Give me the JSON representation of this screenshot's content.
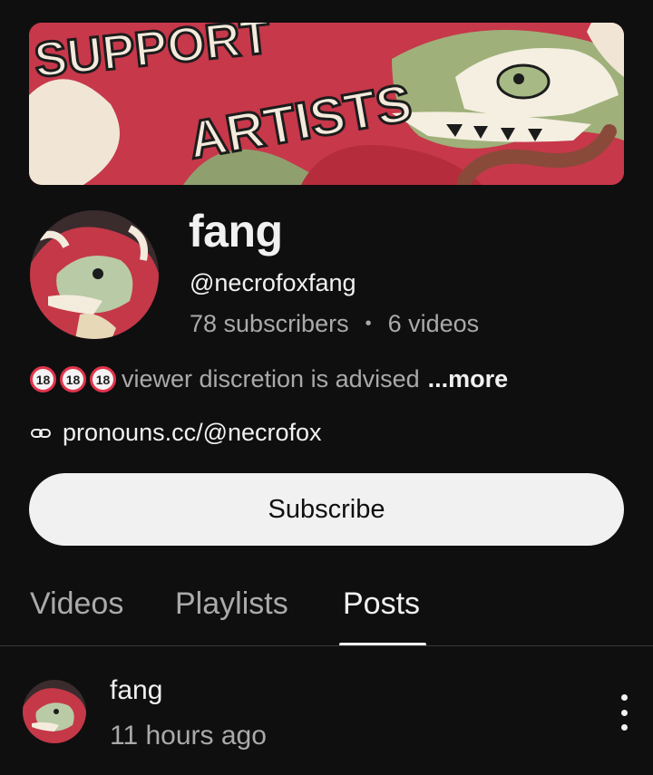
{
  "banner": {
    "text_top": "SUPPORT",
    "text_bottom": "ARTISTS"
  },
  "channel": {
    "name": "fang",
    "handle": "@necrofoxfang",
    "subscribers": "78 subscribers",
    "separator": "•",
    "videos": "6 videos",
    "badge_label": "18",
    "description": "viewer discretion is advised",
    "more_label": "...more",
    "link": "pronouns.cc/@necrofox"
  },
  "subscribe_label": "Subscribe",
  "tabs": [
    {
      "label": "Videos"
    },
    {
      "label": "Playlists"
    },
    {
      "label": "Posts"
    }
  ],
  "post": {
    "author": "fang",
    "time": "11 hours ago"
  },
  "colors": {
    "background": "#0f0f0f",
    "primary_text": "#f1f1f1",
    "secondary_text": "#aaaaaa",
    "badge_ring": "#e0344b"
  },
  "icons": {
    "link": "link-icon",
    "more": "kebab-menu-icon"
  }
}
